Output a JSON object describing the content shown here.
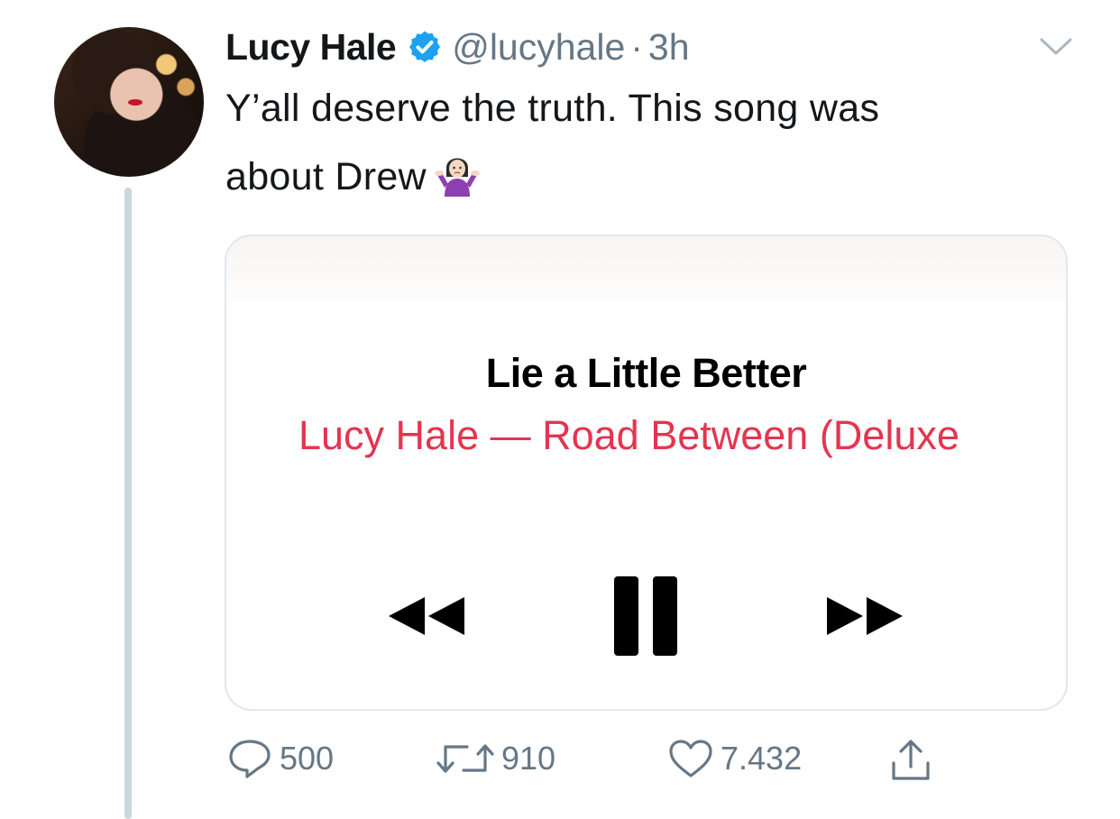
{
  "tweet": {
    "author_name": "Lucy Hale",
    "handle": "@lucyhale",
    "separator": "·",
    "time": "3h",
    "text_line1": "Y’all deserve the truth. This song was",
    "text_line2": "about Drew",
    "emoji": "person-shrugging-emoji"
  },
  "card": {
    "song_title": "Lie a Little Better",
    "song_subtitle": "Lucy Hale — Road Between (Deluxe",
    "controls": [
      "rewind-icon",
      "pause-icon",
      "fast-forward-icon"
    ]
  },
  "actions": {
    "replies": "500",
    "retweets": "910",
    "likes": "7.432"
  },
  "colors": {
    "accent_red": "#e5344f",
    "verified_blue": "#1da1f2",
    "muted": "#657786",
    "thread_line": "#ccd6dd"
  }
}
